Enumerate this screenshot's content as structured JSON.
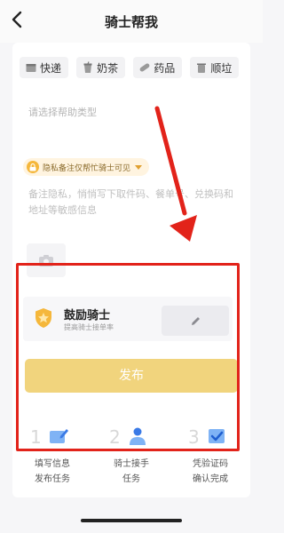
{
  "header": {
    "title": "骑士帮我"
  },
  "chips": [
    {
      "label": "快递",
      "icon": "box-icon"
    },
    {
      "label": "奶茶",
      "icon": "cup-icon"
    },
    {
      "label": "药品",
      "icon": "pill-icon"
    },
    {
      "label": "顺垃",
      "icon": "trash-icon"
    }
  ],
  "form": {
    "help_type_placeholder": "请选择帮助类型",
    "privacy_label": "隐私备注仅帮忙骑士可见",
    "note_placeholder": "备注隐私，悄悄写下取件码、餐单号、兑换码和地址等敏感信息"
  },
  "encourage": {
    "title": "鼓励骑士",
    "subtitle": "提高骑士接单率"
  },
  "publish": {
    "label": "发布"
  },
  "steps": [
    {
      "num": "1",
      "label": "填写信息\n发布任务"
    },
    {
      "num": "2",
      "label": "骑士接手\n任务"
    },
    {
      "num": "3",
      "label": "凭验证码\n确认完成"
    }
  ],
  "colors": {
    "accent": "#f1d47d",
    "highlight": "#e2231a",
    "badge": "#f5b73b"
  }
}
